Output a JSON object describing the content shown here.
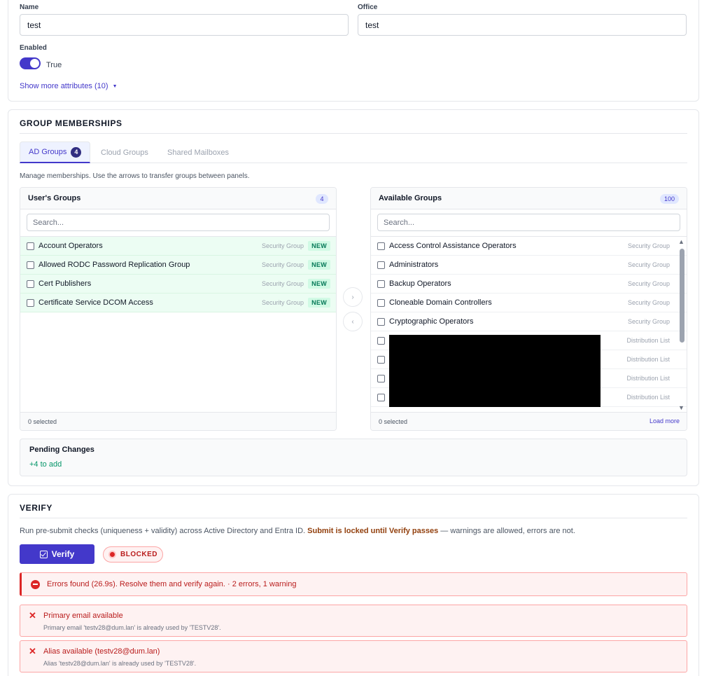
{
  "attributes": {
    "name_label": "Name",
    "name_value": "test",
    "office_label": "Office",
    "office_value": "test",
    "enabled_label": "Enabled",
    "enabled_text": "True",
    "enabled_on": true,
    "show_more": "Show more attributes (10)",
    "show_more_caret": "▼"
  },
  "memberships": {
    "title": "GROUP MEMBERSHIPS",
    "tabs": [
      {
        "label": "AD Groups",
        "badge": "4",
        "active": true
      },
      {
        "label": "Cloud Groups",
        "active": false
      },
      {
        "label": "Shared Mailboxes",
        "active": false
      }
    ],
    "help": "Manage memberships. Use the arrows to transfer groups between panels.",
    "arrows": {
      "right": "›",
      "left": "‹"
    },
    "user_groups": {
      "title": "User's Groups",
      "count": "4",
      "search_placeholder": "Search...",
      "rows": [
        {
          "label": "Account Operators",
          "type": "Security Group",
          "badge": "NEW"
        },
        {
          "label": "Allowed RODC Password Replication Group",
          "type": "Security Group",
          "badge": "NEW"
        },
        {
          "label": "Cert Publishers",
          "type": "Security Group",
          "badge": "NEW"
        },
        {
          "label": "Certificate Service DCOM Access",
          "type": "Security Group",
          "badge": "NEW"
        }
      ],
      "footer": "0 selected"
    },
    "available_groups": {
      "title": "Available Groups",
      "count": "100",
      "search_placeholder": "Search...",
      "rows": [
        {
          "label": "Access Control Assistance Operators",
          "type": "Security Group"
        },
        {
          "label": "Administrators",
          "type": "Security Group"
        },
        {
          "label": "Backup Operators",
          "type": "Security Group"
        },
        {
          "label": "Cloneable Domain Controllers",
          "type": "Security Group"
        },
        {
          "label": "Cryptographic Operators",
          "type": "Security Group"
        },
        {
          "label": "",
          "type": "Distribution List"
        },
        {
          "label": "",
          "type": "Distribution List"
        },
        {
          "label": "",
          "type": "Distribution List"
        },
        {
          "label": "",
          "type": "Distribution List"
        }
      ],
      "footer": "0 selected",
      "load_more": "Load more"
    },
    "pending": {
      "title": "Pending Changes",
      "add": "+4 to add"
    }
  },
  "verify": {
    "title": "VERIFY",
    "desc_pre": "Run pre-submit checks (uniqueness + validity) across Active Directory and Entra ID. ",
    "desc_strong": "Submit is locked until Verify passes",
    "desc_post": " — warnings are allowed, errors are not.",
    "button": "Verify",
    "status": "BLOCKED",
    "summary": "Errors found (26.9s). Resolve them and verify again. · 2 errors, 1 warning",
    "issues": [
      {
        "title": "Primary email available",
        "detail": "Primary email 'testv28@dum.lan' is already used by 'TESTV28'."
      },
      {
        "title": "Alias available (testv28@dum.lan)",
        "detail": "Alias 'testv28@dum.lan' is already used by 'TESTV28'."
      }
    ]
  },
  "colors": {
    "accent": "#4338ca",
    "new_bg": "#ecfdf3",
    "error": "#dc2626",
    "warning_text": "#92400e"
  }
}
